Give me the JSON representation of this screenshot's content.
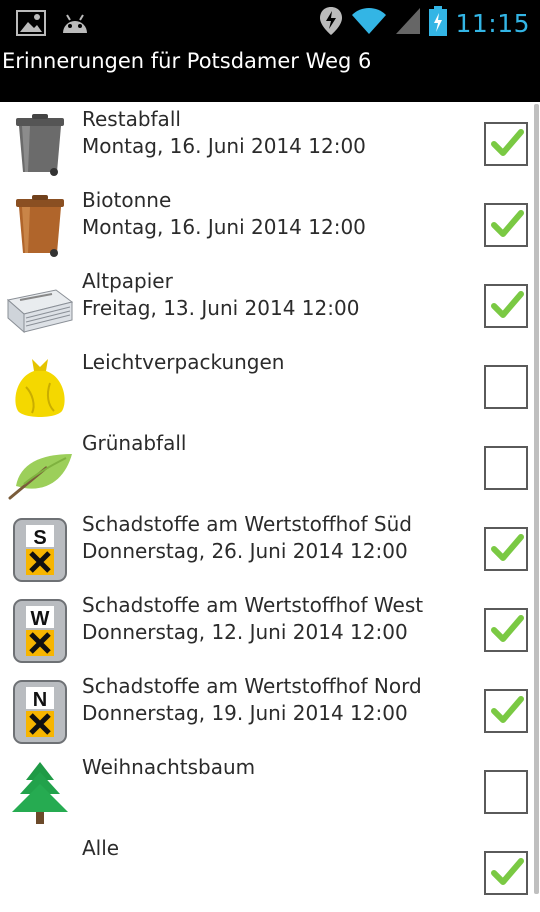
{
  "status_bar": {
    "time": "11:15",
    "icons": [
      "picture-icon",
      "android-icon",
      "location-icon",
      "wifi-icon",
      "signal-icon",
      "battery-charging-icon"
    ]
  },
  "title_bar": {
    "title": "Erinnerungen für Potsdamer Weg 6"
  },
  "items": [
    {
      "label": "Restabfall",
      "date": "Montag, 16. Juni 2014 12:00",
      "checked": true,
      "icon": "grey-bin-icon"
    },
    {
      "label": "Biotonne",
      "date": "Montag, 16. Juni 2014 12:00",
      "checked": true,
      "icon": "brown-bin-icon"
    },
    {
      "label": "Altpapier",
      "date": "Freitag, 13. Juni 2014 12:00",
      "checked": true,
      "icon": "newspaper-icon"
    },
    {
      "label": "Leichtverpackungen",
      "date": "",
      "checked": false,
      "icon": "yellow-bag-icon"
    },
    {
      "label": "Grünabfall",
      "date": "",
      "checked": false,
      "icon": "leaf-icon"
    },
    {
      "label": "Schadstoffe am Wertstoffhof Süd",
      "date": "Donnerstag, 26. Juni 2014 12:00",
      "checked": true,
      "icon": "hazard-barrel-s-icon",
      "letter": "S"
    },
    {
      "label": "Schadstoffe am Wertstoffhof West",
      "date": "Donnerstag, 12. Juni 2014 12:00",
      "checked": true,
      "icon": "hazard-barrel-w-icon",
      "letter": "W"
    },
    {
      "label": "Schadstoffe am Wertstoffhof Nord",
      "date": "Donnerstag, 19. Juni 2014 12:00",
      "checked": true,
      "icon": "hazard-barrel-n-icon",
      "letter": "N"
    },
    {
      "label": "Weihnachtsbaum",
      "date": "",
      "checked": false,
      "icon": "tree-icon"
    },
    {
      "label": "Alle",
      "date": "",
      "checked": true,
      "icon": ""
    }
  ],
  "colors": {
    "checkmark": "#7ac943",
    "clock": "#33b5e5"
  }
}
